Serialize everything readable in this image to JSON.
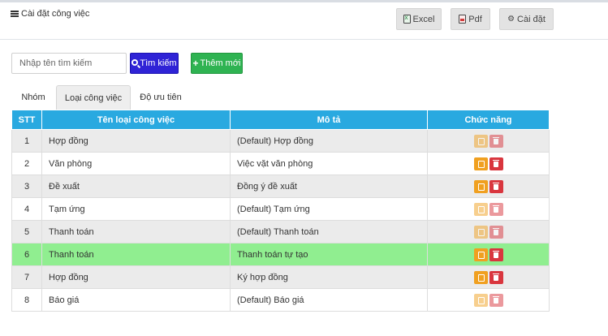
{
  "header": {
    "title": "Cài đặt công việc",
    "buttons": {
      "excel": "Excel",
      "pdf": "Pdf",
      "settings": "Cài đặt"
    }
  },
  "search": {
    "placeholder": "Nhập tên tìm kiếm",
    "value": ""
  },
  "actions": {
    "search_label": "Tìm kiếm",
    "add_label": "Thêm mới"
  },
  "tabs": [
    {
      "label": "Nhóm",
      "active": false
    },
    {
      "label": "Loại công việc",
      "active": true
    },
    {
      "label": "Độ ưu tiên",
      "active": false
    }
  ],
  "table": {
    "columns": [
      "STT",
      "Tên loại công việc",
      "Mô tả",
      "Chức năng"
    ],
    "rows": [
      {
        "stt": "1",
        "name": "Hợp đồng",
        "desc": "(Default) Hợp đồng",
        "enabled": false
      },
      {
        "stt": "2",
        "name": "Văn phòng",
        "desc": "Việc vặt văn phòng",
        "enabled": true
      },
      {
        "stt": "3",
        "name": "Đề xuất",
        "desc": "Đồng ý đề xuất",
        "enabled": true
      },
      {
        "stt": "4",
        "name": "Tạm ứng",
        "desc": "(Default) Tạm ứng",
        "enabled": false
      },
      {
        "stt": "5",
        "name": "Thanh toán",
        "desc": "(Default) Thanh toán",
        "enabled": false
      },
      {
        "stt": "6",
        "name": "Thanh toán",
        "desc": "Thanh toán tự tạo",
        "enabled": true,
        "highlighted": true
      },
      {
        "stt": "7",
        "name": "Hợp đồng",
        "desc": "Ký hợp đồng",
        "enabled": true
      },
      {
        "stt": "8",
        "name": "Báo giá",
        "desc": "(Default) Báo giá",
        "enabled": false
      }
    ]
  },
  "colors": {
    "table_header": "#29a9e0",
    "search_button": "#2f23d6",
    "add_button": "#2fb352",
    "row_highlight": "#90ee90",
    "edit_button": "#f0a020",
    "delete_button": "#d9363e"
  },
  "icons": {
    "title": "menu-icon",
    "excel": "excel-file-icon",
    "pdf": "pdf-file-icon",
    "settings": "gear-icon",
    "search": "search-icon",
    "add": "plus-icon",
    "edit": "edit-icon",
    "delete": "trash-icon"
  }
}
